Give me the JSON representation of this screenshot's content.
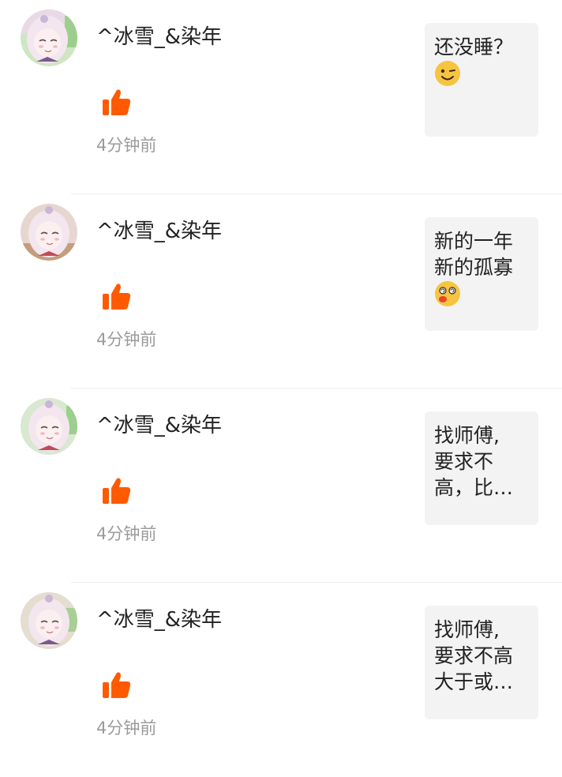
{
  "comments": [
    {
      "username": "^冰雪_&染年",
      "time": "4分钟前",
      "content": "还没睡？",
      "emoji": "wink-emoji"
    },
    {
      "username": "^冰雪_&染年",
      "time": "4分钟前",
      "content": "新的一年\n新的孤寡",
      "emoji": "dizzy-emoji"
    },
    {
      "username": "^冰雪_&染年",
      "time": "4分钟前",
      "content": "找师傅,\n要求不\n高，比…",
      "emoji": null
    },
    {
      "username": "^冰雪_&染年",
      "time": "4分钟前",
      "content": "找师傅,\n要求不高\n大于或…",
      "emoji": null
    }
  ],
  "colors": {
    "like": "#ff5a00",
    "time": "#9b9b9b",
    "bubble_bg": "#f3f3f3",
    "divider": "#ececec"
  },
  "icons": {
    "like": "thumbs-up-icon",
    "avatar": "anime-girl-avatar"
  }
}
